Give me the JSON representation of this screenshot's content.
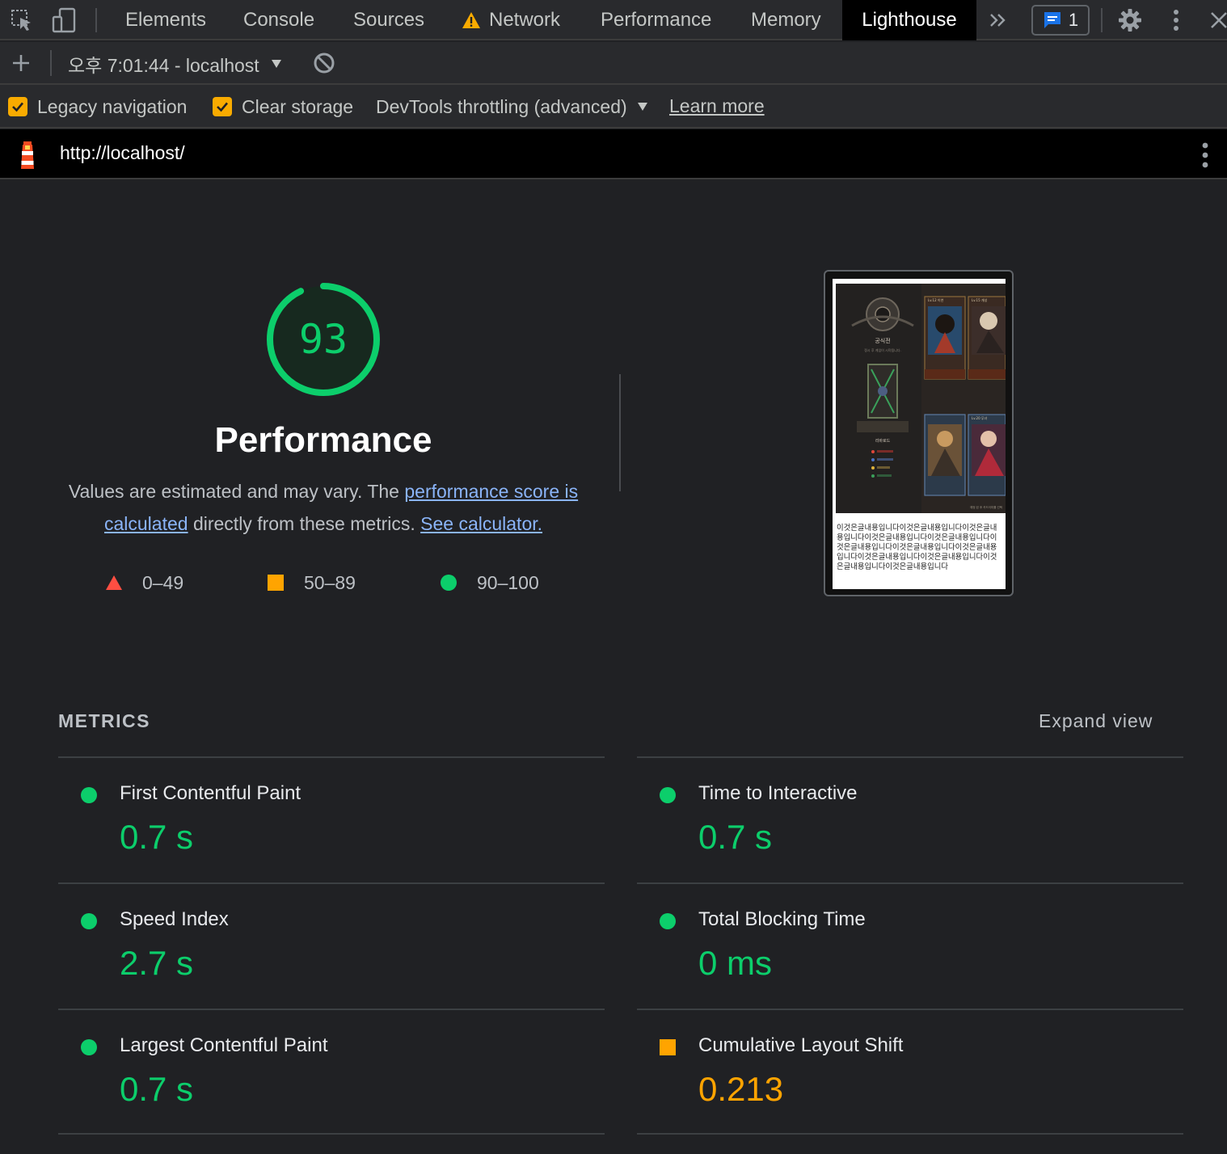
{
  "devtools": {
    "tabs": [
      "Elements",
      "Console",
      "Sources",
      "Network",
      "Performance",
      "Memory",
      "Lighthouse"
    ],
    "active_tab": "Lighthouse",
    "issues_count": "1",
    "network_has_warning": true,
    "icons": [
      "inspect-element-icon",
      "device-toolbar-icon",
      "warning-icon",
      "more-tabs-icon",
      "issues-icon",
      "gear-icon",
      "kebab-menu-icon",
      "close-icon"
    ]
  },
  "toolbar": {
    "report_label": "오후 7:01:44 - localhost"
  },
  "settings": {
    "legacy_navigation": {
      "label": "Legacy navigation",
      "checked": true
    },
    "clear_storage": {
      "label": "Clear storage",
      "checked": true
    },
    "throttling": "DevTools throttling (advanced)",
    "learn_more": "Learn more"
  },
  "report": {
    "url": "http://localhost/",
    "score": "93",
    "category_title": "Performance",
    "desc_pre": "Values are estimated and may vary. The ",
    "desc_link1": "performance score is calculated",
    "desc_mid": " directly from these metrics. ",
    "desc_link2": "See calculator.",
    "legend": {
      "fail": "0–49",
      "average": "50–89",
      "pass": "90–100"
    },
    "colors": {
      "pass": "#0cce6b",
      "average": "#ffa400",
      "fail": "#ff4e42",
      "link": "#8ab4f8"
    },
    "screenshot": {
      "game_title": "공식전",
      "game_subtitle": "정시 후 게임이 시작됩니다.",
      "card_labels": [
        "Lv.12 이연",
        "Lv.15 개성",
        "Lv.20 무녀"
      ],
      "side_label": "리바로드",
      "footer_note": "예정 된 후 카드이미를 선택",
      "body_text": "이것은글내용입니다이것은글내용입니다이것은글내용입니다이것은글내용입니다이것은글내용입니다이것은글내용입니다이것은글내용입니다이것은글내용입니다이것은글내용입니다이것은글내용입니다이것은글내용입니다이것은글내용입니다"
    }
  },
  "metrics": {
    "heading": "METRICS",
    "expand_label": "Expand view",
    "items": [
      {
        "label": "First Contentful Paint",
        "value": "0.7 s",
        "rating": "pass"
      },
      {
        "label": "Time to Interactive",
        "value": "0.7 s",
        "rating": "pass"
      },
      {
        "label": "Speed Index",
        "value": "2.7 s",
        "rating": "pass"
      },
      {
        "label": "Total Blocking Time",
        "value": "0 ms",
        "rating": "pass"
      },
      {
        "label": "Largest Contentful Paint",
        "value": "0.7 s",
        "rating": "pass"
      },
      {
        "label": "Cumulative Layout Shift",
        "value": "0.213",
        "rating": "average"
      }
    ]
  }
}
